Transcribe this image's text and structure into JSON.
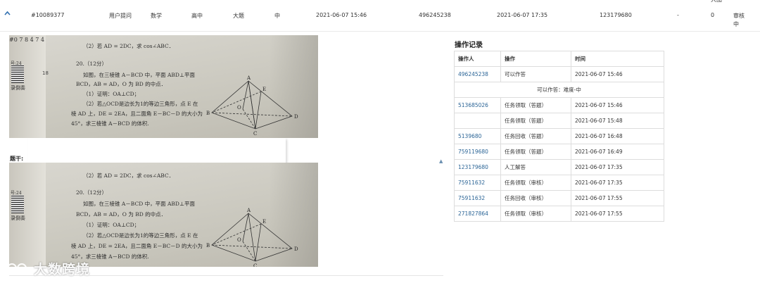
{
  "header_fragment": "大图",
  "top_row": {
    "id": "#10089377",
    "source": "用户提问",
    "subject": "数学",
    "grade": "高中",
    "type": "大题",
    "difficulty": "中",
    "created_time": "2021-06-07 15:46",
    "creator": "496245238",
    "updated_time": "2021-06-07 17:35",
    "answerer": "123179680",
    "dash": "-",
    "count": "0",
    "status": "审核中"
  },
  "question": {
    "stem_label": "题干:",
    "side_numbers": "#0 7 8 4 7 4",
    "page_number": "18",
    "barcode_label": "号:24",
    "barcode_sub": "录倒奏",
    "lines": [
      "（2）若 AD = 2DC，求 cos∠ABC．",
      "20.（12分）",
      "如图，在三棱锥 A－BCD 中，平面 ABD⊥平面",
      "BCD，AB = AD，O 为 BD 的中点．",
      "（1）证明：OA⊥CD；",
      "（2）若△OCD是边长为1的等边三角形，点 E 在",
      "棱 AD 上，DE = 2EA，且二面角 E－BC－D 的大小为",
      "45°，求三棱锥 A－BCD 的体积."
    ],
    "diagram_labels": [
      "A",
      "B",
      "C",
      "D",
      "E",
      "O"
    ]
  },
  "watermark": "大数跨境",
  "log": {
    "title": "操作记录",
    "headers": {
      "operator": "操作人",
      "action": "操作",
      "time": "时间"
    },
    "rows": [
      {
        "operator": "496245238",
        "action": "可以作答",
        "time": "2021-06-07 15:46"
      },
      {
        "note": "可以作答：难度-中"
      },
      {
        "operator": "513685026",
        "action": "任务领取（答题）",
        "time": "2021-06-07 15:46"
      },
      {
        "operator": "",
        "action": "任务领取（答题）",
        "time": "2021-06-07 15:48"
      },
      {
        "operator": "5139680",
        "action": "任务回收（答题）",
        "time": "2021-06-07 16:48"
      },
      {
        "operator": "759119680",
        "action": "任务领取（答题）",
        "time": "2021-06-07 16:49"
      },
      {
        "operator": "123179680",
        "action": "人工解答",
        "time": "2021-06-07 17:35"
      },
      {
        "operator": "75911632",
        "action": "任务领取（审核）",
        "time": "2021-06-07 17:35"
      },
      {
        "operator": "75911632",
        "action": "任务回收（审核）",
        "time": "2021-06-07 17:55"
      },
      {
        "operator": "271827864",
        "action": "任务领取（审核）",
        "time": "2021-06-07 17:55"
      }
    ]
  }
}
